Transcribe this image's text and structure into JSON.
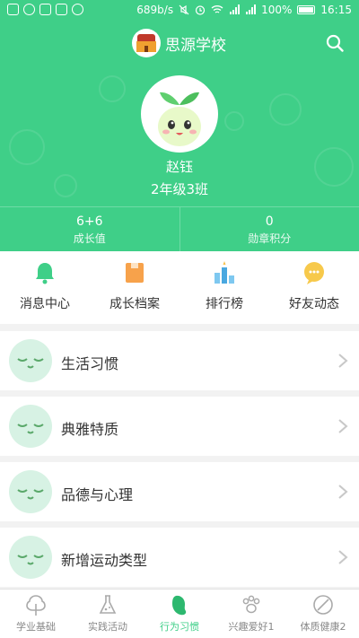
{
  "status_bar": {
    "speed": "689b/s",
    "battery_percent": "100%",
    "time": "16:15",
    "icons": [
      "app-icon",
      "shield-icon",
      "image-icon",
      "grid-icon",
      "chat-icon",
      "mute-icon",
      "alarm-icon",
      "wifi-icon",
      "signal-icon",
      "signal-icon",
      "battery-icon"
    ]
  },
  "header": {
    "school_name": "思源学校",
    "user_name": "赵钰",
    "user_class": "2年级3班",
    "stats": [
      {
        "value": "6+6",
        "label": "成长值"
      },
      {
        "value": "0",
        "label": "勋章积分"
      }
    ]
  },
  "quick_menu": [
    {
      "label": "消息中心",
      "icon": "bell-icon"
    },
    {
      "label": "成长档案",
      "icon": "folder-icon"
    },
    {
      "label": "排行榜",
      "icon": "ranking-icon"
    },
    {
      "label": "好友动态",
      "icon": "chat-bubble-icon"
    }
  ],
  "habits": [
    {
      "label": "生活习惯"
    },
    {
      "label": "典雅特质"
    },
    {
      "label": "品德与心理"
    },
    {
      "label": "新增运动类型"
    }
  ],
  "bottom_nav": [
    {
      "label": "学业基础",
      "icon": "tree-icon",
      "active": false
    },
    {
      "label": "实践活动",
      "icon": "flask-icon",
      "active": false
    },
    {
      "label": "行为习惯",
      "icon": "bean-icon",
      "active": true
    },
    {
      "label": "兴趣爱好1",
      "icon": "paw-icon",
      "active": false
    },
    {
      "label": "体质健康2",
      "icon": "leaf-icon",
      "active": false
    }
  ],
  "colors": {
    "primary": "#3fcf88",
    "active_tab": "#2db86f",
    "background": "#f2f2f2"
  }
}
